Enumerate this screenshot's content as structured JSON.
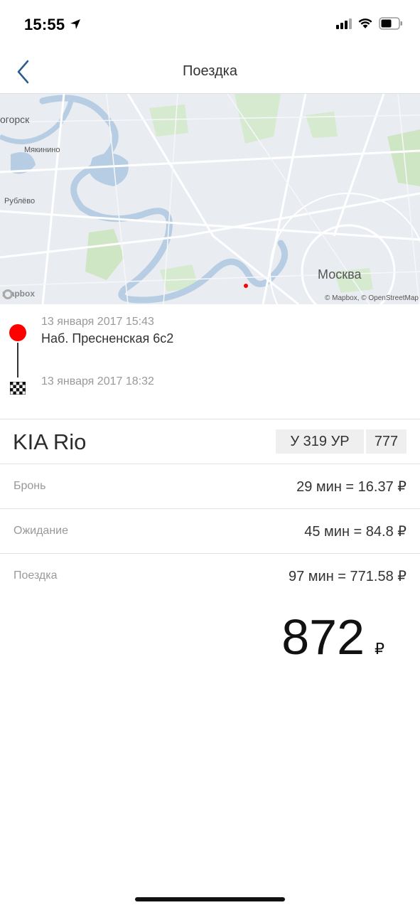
{
  "status_bar": {
    "time": "15:55",
    "icons": [
      "location-arrow-icon",
      "cellular-signal-icon",
      "wifi-icon",
      "battery-icon"
    ]
  },
  "nav": {
    "title": "Поездка",
    "back_icon": "chevron-left-icon"
  },
  "map": {
    "labels": {
      "krasnogorsk": "огорск",
      "myakinino": "Мякинино",
      "rublevo": "Рублёво",
      "moscow": "Москва"
    },
    "logo_text": "mapbox",
    "attribution": "© Mapbox, © OpenStreetMap"
  },
  "trip": {
    "start_time": "13 января 2017 15:43",
    "start_address": "Наб. Пресненская 6с2",
    "end_time": "13 января 2017 18:32",
    "start_color": "#ff0000"
  },
  "car": {
    "model": "KIA Rio",
    "plate": "У 319 УР",
    "region": "777"
  },
  "costs": {
    "booking_label": "Бронь",
    "booking_value": "29 мин = 16.37 ₽",
    "waiting_label": "Ожидание",
    "waiting_value": "45 мин = 84.8 ₽",
    "ride_label": "Поездка",
    "ride_value": "97 мин = 771.58 ₽"
  },
  "total": {
    "amount": "872",
    "currency": "₽"
  },
  "colors": {
    "accent": "#2c5c8a",
    "map_bg": "#e9ecf1",
    "water": "#b6cde3",
    "park": "#cfe6c4"
  }
}
